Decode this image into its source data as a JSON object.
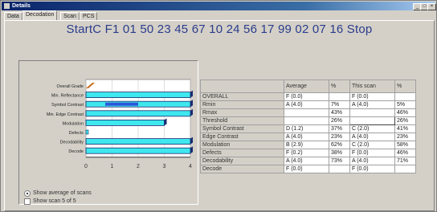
{
  "window": {
    "title": "Details"
  },
  "title_buttons": [
    "_",
    "□",
    "×"
  ],
  "tabs": [
    {
      "label": "Data",
      "active": false
    },
    {
      "label": "Decodation",
      "active": true
    },
    {
      "label": "Scan",
      "active": false
    },
    {
      "label": "PCS",
      "active": false
    }
  ],
  "decode_string": "StartC F1 01 50 23 45 67 10 24 56 17 99 02 07 16 Stop",
  "chart_data": {
    "type": "bar",
    "orientation": "horizontal",
    "categories": [
      "Overall Grade",
      "Min. Reflectance",
      "Symbol Contrast",
      "Min. Edge Contrast",
      "Modulation",
      "Defects",
      "Decodability",
      "Decode"
    ],
    "series": [
      {
        "values": [
          0,
          4,
          4,
          4,
          3,
          0,
          4,
          4
        ]
      },
      {
        "values": [
          0,
          0,
          2,
          0,
          0,
          0,
          0,
          0
        ]
      }
    ],
    "xlim": [
      0,
      4
    ],
    "xticks": [
      "0",
      "1",
      "2",
      "3",
      "4"
    ],
    "colors": {
      "main": "#3ee8ee",
      "secondary": "#2d57d9",
      "grade_marker": "#c86a1c"
    }
  },
  "options": [
    {
      "label": "Show average of scans",
      "selected": true
    },
    {
      "label": "Show scan 5 of 5",
      "selected": false
    }
  ],
  "table": {
    "headers": [
      "",
      "Average",
      "%",
      "This scan",
      "%"
    ],
    "rows": [
      [
        "OVERALL",
        "F (0.0)",
        "",
        "F (0.0)",
        ""
      ],
      [
        "Rmin",
        "A (4.0)",
        "7%",
        "A (4.0)",
        "5%"
      ],
      [
        "Rmax",
        "",
        "43%",
        "",
        "46%"
      ],
      [
        "Threshold",
        "",
        "26%",
        "",
        "26%"
      ],
      [
        "Symbol Contrast",
        "D (1.2)",
        "37%",
        "C (2.0)",
        "41%"
      ],
      [
        "Edge Contrast",
        "A (4.0)",
        "23%",
        "A (4.0)",
        "23%"
      ],
      [
        "Modulation",
        "B (2.9)",
        "62%",
        "C (2.0)",
        "58%"
      ],
      [
        "Defects",
        "F (0.2)",
        "38%",
        "F (0.0)",
        "46%"
      ],
      [
        "Decodability",
        "A (4.0)",
        "73%",
        "A (4.0)",
        "71%"
      ],
      [
        "Decode",
        "F (0.0)",
        "",
        "F (0.0)",
        ""
      ]
    ]
  }
}
